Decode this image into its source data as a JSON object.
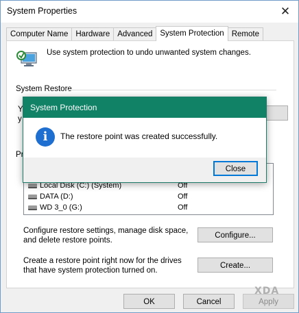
{
  "window": {
    "title": "System Properties"
  },
  "tabs": [
    {
      "label": "Computer Name"
    },
    {
      "label": "Hardware"
    },
    {
      "label": "Advanced"
    },
    {
      "label": "System Protection",
      "active": true
    },
    {
      "label": "Remote"
    }
  ],
  "intro_text": "Use system protection to undo unwanted system changes.",
  "restore_group": {
    "label": "System Restore",
    "partial_text_line1": "Y",
    "partial_text_line2": "y"
  },
  "protection_group_partial": "Pr",
  "drives": [
    {
      "name": "Local Disk (C:) (System)",
      "protection": "Off"
    },
    {
      "name": "DATA (D:)",
      "protection": "Off"
    },
    {
      "name": "WD 3_0 (G:)",
      "protection": "Off"
    }
  ],
  "configure": {
    "text": "Configure restore settings, manage disk space, and delete restore points.",
    "button": "Configure..."
  },
  "create": {
    "text": "Create a restore point right now for the drives that have system protection turned on.",
    "button": "Create..."
  },
  "footer": {
    "ok": "OK",
    "cancel": "Cancel",
    "apply": "Apply"
  },
  "watermark": "XDA",
  "dialog": {
    "title": "System Protection",
    "message": "The restore point was created successfully.",
    "close_button": "Close",
    "icon": "info-icon",
    "title_color": "#128266"
  }
}
